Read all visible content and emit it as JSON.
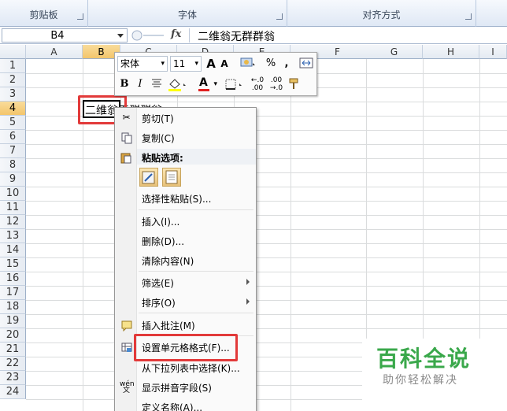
{
  "ribbon": {
    "groups": [
      "剪贴板",
      "字体",
      "对齐方式"
    ]
  },
  "formula_bar": {
    "name_box": "B4",
    "fx_label": "fx",
    "content": "二维翁无群群翁"
  },
  "sheet": {
    "columns": [
      "A",
      "B",
      "C",
      "D",
      "E",
      "F",
      "G",
      "H",
      "I"
    ],
    "rows": [
      "1",
      "2",
      "3",
      "4",
      "5",
      "6",
      "7",
      "8",
      "9",
      "10",
      "11",
      "12",
      "13",
      "14",
      "15",
      "16",
      "17",
      "18",
      "19",
      "20",
      "21",
      "22",
      "23",
      "24"
    ],
    "selected_cell": "B4",
    "cell_text": "二维翁无群群翁"
  },
  "mini_toolbar": {
    "font_name": "宋体",
    "font_size": "11",
    "grow_font": "A",
    "shrink_font": "A",
    "percent": "%",
    "comma": ",",
    "bold": "B",
    "italic": "I",
    "font_color": "A",
    "inc_decimal": "←.0 .00",
    "dec_decimal": ".00 →.0"
  },
  "context_menu": {
    "items": [
      {
        "label": "剪切(T)",
        "icon": "scissors-icon"
      },
      {
        "label": "复制(C)",
        "icon": "copy-icon"
      },
      {
        "label": "粘贴选项:",
        "icon": "paste-icon"
      },
      {
        "label": "选择性粘贴(S)...",
        "icon": ""
      },
      {
        "label": "插入(I)...",
        "icon": ""
      },
      {
        "label": "删除(D)...",
        "icon": ""
      },
      {
        "label": "清除内容(N)",
        "icon": ""
      },
      {
        "label": "筛选(E)",
        "icon": ""
      },
      {
        "label": "排序(O)",
        "icon": ""
      },
      {
        "label": "插入批注(M)",
        "icon": "comment-icon"
      },
      {
        "label": "设置单元格格式(F)...",
        "icon": "format-cells-icon"
      },
      {
        "label": "从下拉列表中选择(K)...",
        "icon": ""
      },
      {
        "label": "显示拼音字段(S)",
        "icon": "phonetic-icon"
      },
      {
        "label": "定义名称(A)...",
        "icon": ""
      }
    ]
  },
  "watermark": {
    "title": "百科全说",
    "subtitle": "助你轻松解决"
  },
  "colors": {
    "highlight_red": "#e23a3a",
    "logo_green": "#3aa84b"
  }
}
